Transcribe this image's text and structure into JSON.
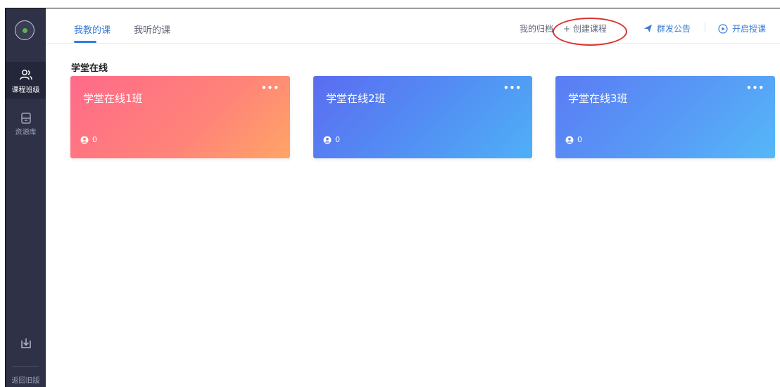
{
  "sidebar": {
    "items": [
      {
        "label": "课程班级",
        "icon": "class-group-icon",
        "active": true
      },
      {
        "label": "资源库",
        "icon": "resource-library-icon",
        "active": false
      }
    ],
    "bottom_icon": "download-icon",
    "back_label": "返回旧版"
  },
  "header": {
    "tabs": [
      {
        "label": "我教的课",
        "active": true
      },
      {
        "label": "我听的课",
        "active": false
      }
    ],
    "archive_label": "我的归档",
    "create_label": "+ 创建课程",
    "announce_label": "群发公告",
    "start_label": "开启授课"
  },
  "group": {
    "title": "学堂在线",
    "cards": [
      {
        "name": "学堂在线1班",
        "count": "0",
        "more": "•••"
      },
      {
        "name": "学堂在线2班",
        "count": "0",
        "more": "•••"
      },
      {
        "name": "学堂在线3班",
        "count": "0",
        "more": "•••"
      }
    ]
  },
  "colors": {
    "sidebar_bg": "#2f3247",
    "accent": "#3a7bd5",
    "card1_gradient": [
      "#ff6a8a",
      "#ffa566"
    ],
    "card2_gradient": [
      "#5b6cf0",
      "#4fb0f6"
    ],
    "card3_gradient": [
      "#5b7cf4",
      "#55b8f8"
    ],
    "annotation": "#d9322f"
  }
}
